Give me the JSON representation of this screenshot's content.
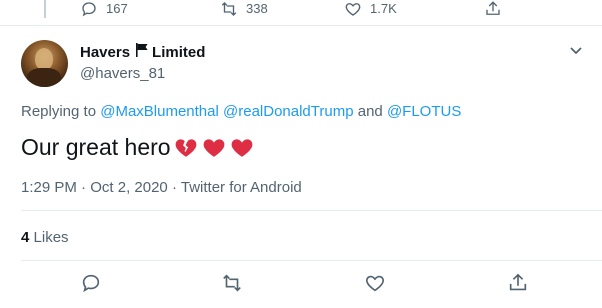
{
  "previous_tweet": {
    "reply_count": "167",
    "retweet_count": "338",
    "like_count": "1.7K"
  },
  "tweet": {
    "display_name_first": "Havers",
    "display_name_second": "Limited",
    "flag_icon": "black-flag-icon",
    "handle": "@havers_81",
    "replying_prefix": "Replying to",
    "reply_to": [
      "@MaxBlumenthal",
      "@realDonaldTrump",
      "@FLOTUS"
    ],
    "reply_and": "and",
    "text": "Our great hero",
    "emojis": [
      "broken-heart-icon",
      "red-heart-icon",
      "red-heart-icon"
    ],
    "time": "1:29 PM",
    "date": "Oct 2, 2020",
    "source": "Twitter for Android",
    "meta_separator": "·",
    "likes_count": "4",
    "likes_label": "Likes"
  },
  "colors": {
    "link": "#1d9bf0",
    "muted": "#536471",
    "heart": "#e0245e"
  }
}
